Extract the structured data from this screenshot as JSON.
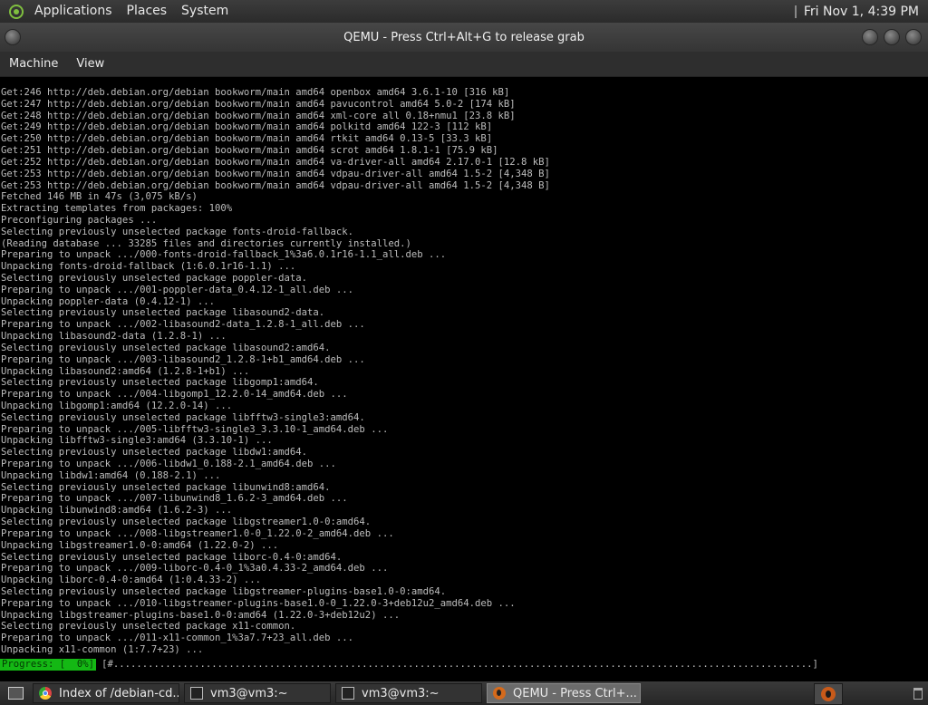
{
  "top_panel": {
    "menus": [
      "Applications",
      "Places",
      "System"
    ],
    "clock": "Fri Nov 1,  4:39 PM",
    "distro_icon": "distro-logo-icon"
  },
  "window": {
    "title": "QEMU - Press Ctrl+Alt+G to release grab",
    "menubar": [
      "Machine",
      "View"
    ]
  },
  "console": {
    "lines": [
      "Get:246 http://deb.debian.org/debian bookworm/main amd64 openbox amd64 3.6.1-10 [316 kB]",
      "Get:247 http://deb.debian.org/debian bookworm/main amd64 pavucontrol amd64 5.0-2 [174 kB]",
      "Get:248 http://deb.debian.org/debian bookworm/main amd64 xml-core all 0.18+nmu1 [23.8 kB]",
      "Get:249 http://deb.debian.org/debian bookworm/main amd64 polkitd amd64 122-3 [112 kB]",
      "Get:250 http://deb.debian.org/debian bookworm/main amd64 rtkit amd64 0.13-5 [33.3 kB]",
      "Get:251 http://deb.debian.org/debian bookworm/main amd64 scrot amd64 1.8.1-1 [75.9 kB]",
      "Get:252 http://deb.debian.org/debian bookworm/main amd64 va-driver-all amd64 2.17.0-1 [12.8 kB]",
      "Get:253 http://deb.debian.org/debian bookworm/main amd64 vdpau-driver-all amd64 1.5-2 [4,348 B]",
      "Get:253 http://deb.debian.org/debian bookworm/main amd64 vdpau-driver-all amd64 1.5-2 [4,348 B]",
      "Fetched 146 MB in 47s (3,075 kB/s)",
      "Extracting templates from packages: 100%",
      "Preconfiguring packages ...",
      "Selecting previously unselected package fonts-droid-fallback.",
      "(Reading database ... 33285 files and directories currently installed.)",
      "Preparing to unpack .../000-fonts-droid-fallback_1%3a6.0.1r16-1.1_all.deb ...",
      "Unpacking fonts-droid-fallback (1:6.0.1r16-1.1) ...",
      "Selecting previously unselected package poppler-data.",
      "Preparing to unpack .../001-poppler-data_0.4.12-1_all.deb ...",
      "Unpacking poppler-data (0.4.12-1) ...",
      "Selecting previously unselected package libasound2-data.",
      "Preparing to unpack .../002-libasound2-data_1.2.8-1_all.deb ...",
      "Unpacking libasound2-data (1.2.8-1) ...",
      "Selecting previously unselected package libasound2:amd64.",
      "Preparing to unpack .../003-libasound2_1.2.8-1+b1_amd64.deb ...",
      "Unpacking libasound2:amd64 (1.2.8-1+b1) ...",
      "Selecting previously unselected package libgomp1:amd64.",
      "Preparing to unpack .../004-libgomp1_12.2.0-14_amd64.deb ...",
      "Unpacking libgomp1:amd64 (12.2.0-14) ...",
      "Selecting previously unselected package libfftw3-single3:amd64.",
      "Preparing to unpack .../005-libfftw3-single3_3.3.10-1_amd64.deb ...",
      "Unpacking libfftw3-single3:amd64 (3.3.10-1) ...",
      "Selecting previously unselected package libdw1:amd64.",
      "Preparing to unpack .../006-libdw1_0.188-2.1_amd64.deb ...",
      "Unpacking libdw1:amd64 (0.188-2.1) ...",
      "Selecting previously unselected package libunwind8:amd64.",
      "Preparing to unpack .../007-libunwind8_1.6.2-3_amd64.deb ...",
      "Unpacking libunwind8:amd64 (1.6.2-3) ...",
      "Selecting previously unselected package libgstreamer1.0-0:amd64.",
      "Preparing to unpack .../008-libgstreamer1.0-0_1.22.0-2_amd64.deb ...",
      "Unpacking libgstreamer1.0-0:amd64 (1.22.0-2) ...",
      "Selecting previously unselected package liborc-0.4-0:amd64.",
      "Preparing to unpack .../009-liborc-0.4-0_1%3a0.4.33-2_amd64.deb ...",
      "Unpacking liborc-0.4-0:amd64 (1:0.4.33-2) ...",
      "Selecting previously unselected package libgstreamer-plugins-base1.0-0:amd64.",
      "Preparing to unpack .../010-libgstreamer-plugins-base1.0-0_1.22.0-3+deb12u2_amd64.deb ...",
      "Unpacking libgstreamer-plugins-base1.0-0:amd64 (1.22.0-3+deb12u2) ...",
      "Selecting previously unselected package x11-common.",
      "Preparing to unpack .../011-x11-common_1%3a7.7+23_all.deb ...",
      "Unpacking x11-common (1:7.7+23) ..."
    ],
    "progress_label": "Progress: [  0%]",
    "progress_bar": "[#.........................................................................................................................]",
    "progress_end": "]",
    "progress_fraction": 0.0
  },
  "taskbar": {
    "tasks": [
      {
        "label": "Index of /debian-cd...",
        "icon": "chrome-icon"
      },
      {
        "label": "vm3@vm3:~",
        "icon": "terminal-icon"
      },
      {
        "label": "vm3@vm3:~",
        "icon": "terminal-icon"
      },
      {
        "label": "QEMU - Press Ctrl+...",
        "icon": "qemu-icon"
      }
    ],
    "active_task": 3
  }
}
